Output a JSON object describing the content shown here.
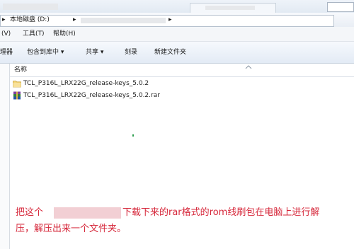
{
  "address": {
    "crumbs": [
      "▸",
      "本地磁盘 (D:)",
      "▸",
      "▸"
    ]
  },
  "menu": [
    "(V)",
    "工具(T)",
    "帮助(H)"
  ],
  "toolbar": [
    "理器",
    "包含到库中 ▾",
    "共享 ▾",
    "刻录",
    "新建文件夹"
  ],
  "list": {
    "column_name": "名称",
    "files": [
      {
        "name": "TCL_P316L_LRX22G_release-keys_5.0.2",
        "icon": "folder-icon"
      },
      {
        "name": "TCL_P316L_LRX22G_release-keys_5.0.2.rar",
        "icon": "rar-archive-icon"
      }
    ]
  },
  "annotation": {
    "line1_start": "把这个",
    "line1_end": "下载下来的rar格式的rom线刷包在电脑上进行解",
    "line2": "压，解压出来一个文件夹。"
  },
  "colors": {
    "annotation": "#d6273a",
    "toolbar_bg": "#e3ebf5"
  }
}
